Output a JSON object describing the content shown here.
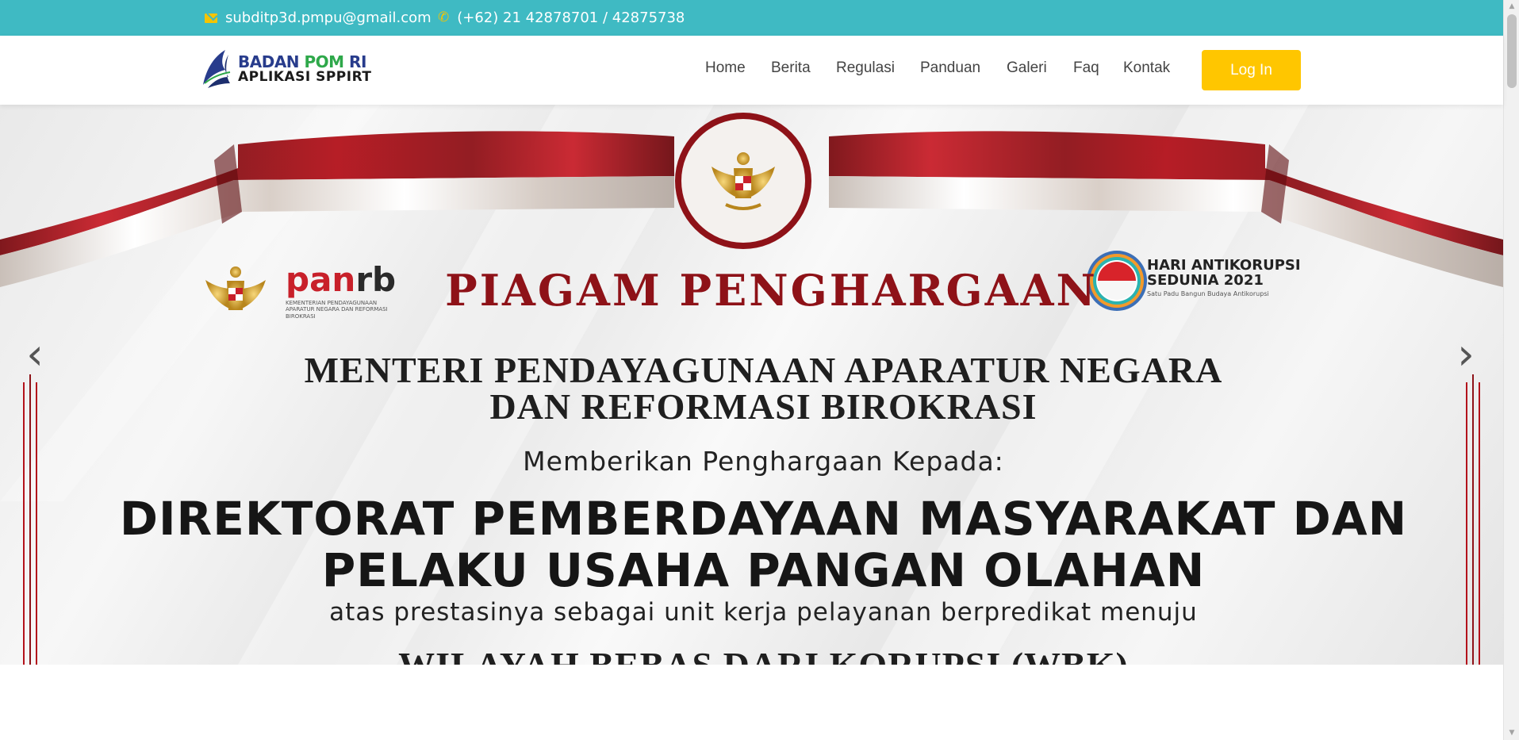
{
  "topbar": {
    "email": "subditp3d.pmpu@gmail.com",
    "phone": "(+62) 21 42878701 / 42875738",
    "email_icon": "envelope-icon",
    "phone_icon": "phone-icon",
    "bg_color": "#3fbac3",
    "icon_color": "#f5c400"
  },
  "brand": {
    "line1_a": "BADAN ",
    "line1_b": "POM",
    "line1_c": " RI",
    "line2": "APLIKASI SPPIRT"
  },
  "nav": {
    "items": [
      "Home",
      "Berita",
      "Regulasi",
      "Panduan",
      "Galeri",
      "Faq",
      "Kontak"
    ],
    "login_label": "Log In",
    "login_color": "#ffc600"
  },
  "hero": {
    "panrb_a": "pan",
    "panrb_b": "rb",
    "panrb_sub": "KEMENTERIAN PENDAYAGUNAAN APARATUR NEGARA DAN REFORMASI BIROKRASI",
    "title": "PIAGAM PENGHARGAAN",
    "hak_line1": "HARI ANTIKORUPSI",
    "hak_line2": "SEDUNIA 2021",
    "hak_tagline": "Satu Padu Bangun Budaya Antikorupsi",
    "menteri_line1": "MENTERI PENDAYAGUNAAN APARATUR NEGARA",
    "menteri_line2": "DAN REFORMASI BIROKRASI",
    "memberikan": "Memberikan Penghargaan Kepada:",
    "recipient_line1": "DIREKTORAT PEMBERDAYAAN MASYARAKAT DAN",
    "recipient_line2": "PELAKU USAHA PANGAN OLAHAN",
    "atas": "atas prestasinya sebagai unit kerja pelayanan berpredikat menuju",
    "wbk": "WILAYAH BEBAS DARI KORUPSI (WBK)",
    "prev_icon": "chevron-left-icon",
    "next_icon": "chevron-right-icon",
    "ribbon_red": "#b3121b",
    "title_color": "#8e1218"
  }
}
